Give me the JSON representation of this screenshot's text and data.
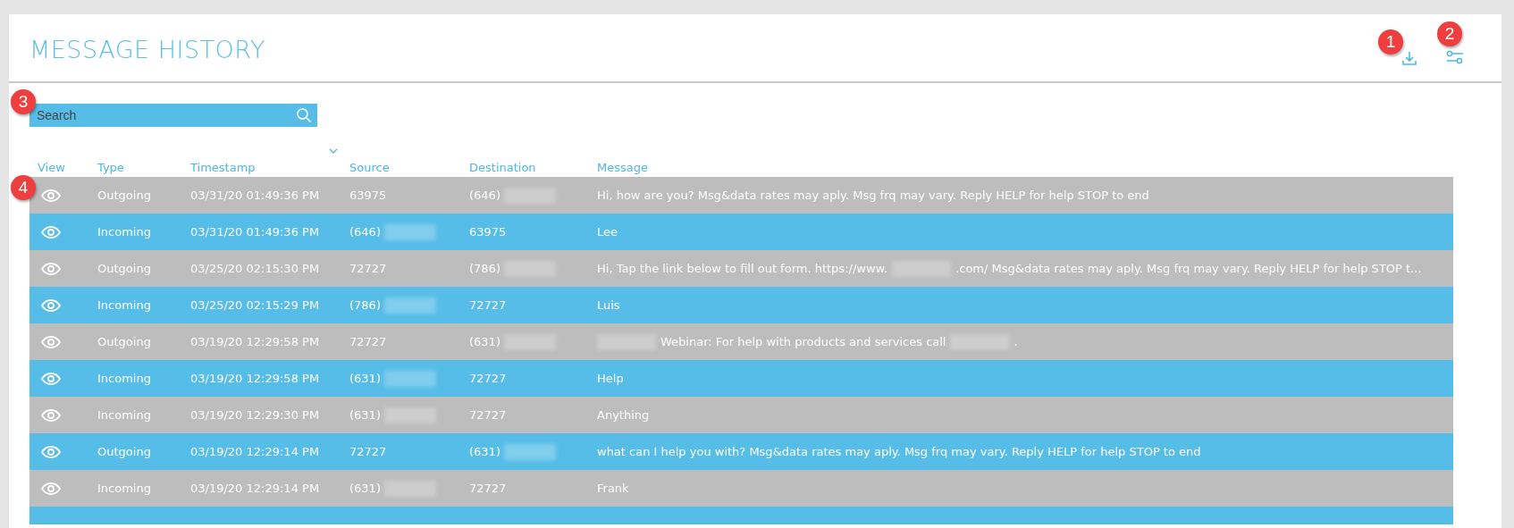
{
  "title": "MESSAGE HISTORY",
  "search": {
    "placeholder": "Search"
  },
  "callouts": [
    "1",
    "2",
    "3",
    "4"
  ],
  "columns": [
    {
      "label": "View",
      "sorted": false
    },
    {
      "label": "Type",
      "sorted": false
    },
    {
      "label": "Timestamp",
      "sorted": true
    },
    {
      "label": "Source",
      "sorted": false
    },
    {
      "label": "Destination",
      "sorted": false
    },
    {
      "label": "Message",
      "sorted": false
    }
  ],
  "rows": [
    {
      "type": "Outgoing",
      "timestamp": "03/31/20 01:49:36 PM",
      "source": {
        "text": "63975",
        "redacted": false
      },
      "destination": {
        "text": "(646)",
        "redacted": true
      },
      "message": [
        {
          "kind": "text",
          "text": "Hi, how are you? Msg&data rates may aply. Msg frq may vary. Reply HELP for help STOP to end"
        }
      ]
    },
    {
      "type": "Incoming",
      "timestamp": "03/31/20 01:49:36 PM",
      "source": {
        "text": "(646)",
        "redacted": true
      },
      "destination": {
        "text": "63975",
        "redacted": false
      },
      "message": [
        {
          "kind": "text",
          "text": "Lee"
        }
      ]
    },
    {
      "type": "Outgoing",
      "timestamp": "03/25/20 02:15:30 PM",
      "source": {
        "text": "72727",
        "redacted": false
      },
      "destination": {
        "text": "(786)",
        "redacted": true
      },
      "message": [
        {
          "kind": "text",
          "text": "Hi, Tap the link below to fill out form. https://www."
        },
        {
          "kind": "redacted"
        },
        {
          "kind": "text",
          "text": ".com/ Msg&data rates may aply. Msg frq may vary. Reply HELP for help STOP t..."
        }
      ]
    },
    {
      "type": "Incoming",
      "timestamp": "03/25/20 02:15:29 PM",
      "source": {
        "text": "(786)",
        "redacted": true
      },
      "destination": {
        "text": "72727",
        "redacted": false
      },
      "message": [
        {
          "kind": "text",
          "text": "Luis"
        }
      ]
    },
    {
      "type": "Outgoing",
      "timestamp": "03/19/20 12:29:58 PM",
      "source": {
        "text": "72727",
        "redacted": false
      },
      "destination": {
        "text": "(631)",
        "redacted": true
      },
      "message": [
        {
          "kind": "redacted"
        },
        {
          "kind": "text",
          "text": "Webinar: For help with products and services call"
        },
        {
          "kind": "redacted"
        },
        {
          "kind": "text",
          "text": "."
        }
      ]
    },
    {
      "type": "Incoming",
      "timestamp": "03/19/20 12:29:58 PM",
      "source": {
        "text": "(631)",
        "redacted": true
      },
      "destination": {
        "text": "72727",
        "redacted": false
      },
      "message": [
        {
          "kind": "text",
          "text": "Help"
        }
      ]
    },
    {
      "type": "Incoming",
      "timestamp": "03/19/20 12:29:30 PM",
      "source": {
        "text": "(631)",
        "redacted": true
      },
      "destination": {
        "text": "72727",
        "redacted": false
      },
      "message": [
        {
          "kind": "text",
          "text": "Anything"
        }
      ]
    },
    {
      "type": "Outgoing",
      "timestamp": "03/19/20 12:29:14 PM",
      "source": {
        "text": "72727",
        "redacted": false
      },
      "destination": {
        "text": "(631)",
        "redacted": true
      },
      "message": [
        {
          "kind": "text",
          "text": "what can I help you with? Msg&data rates may aply. Msg frq may vary. Reply HELP for help STOP to end"
        }
      ]
    },
    {
      "type": "Incoming",
      "timestamp": "03/19/20 12:29:14 PM",
      "source": {
        "text": "(631)",
        "redacted": true
      },
      "destination": {
        "text": "72727",
        "redacted": false
      },
      "message": [
        {
          "kind": "text",
          "text": "Frank"
        }
      ]
    }
  ]
}
